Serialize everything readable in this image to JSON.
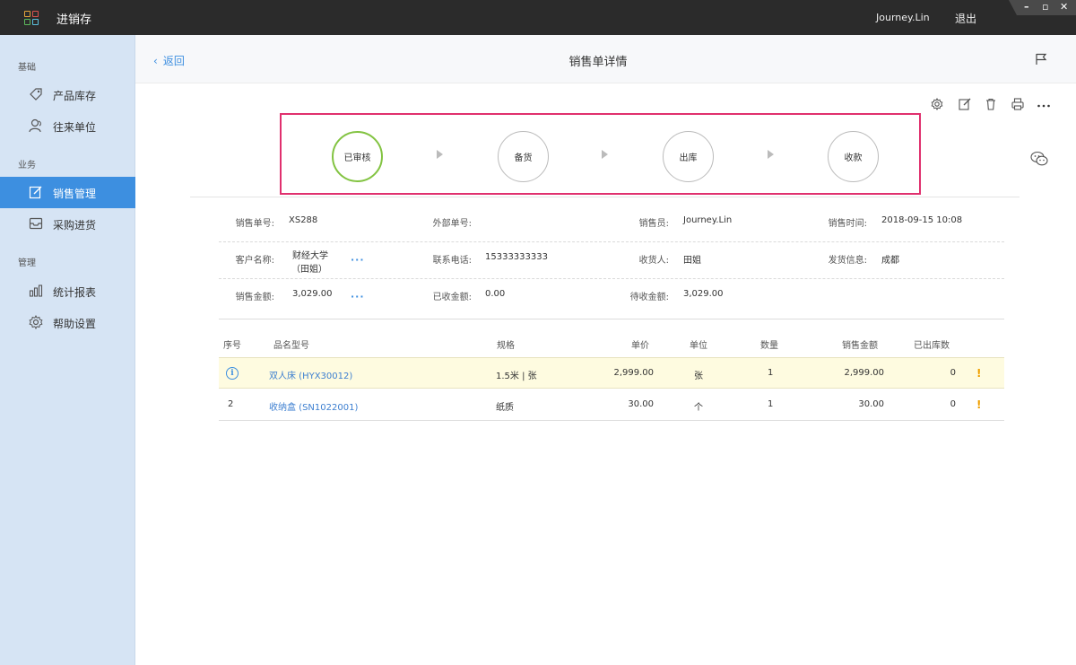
{
  "titlebar": {
    "app_title": "进销存",
    "user_name": "Journey.Lin",
    "logout": "退出",
    "minimize": "–",
    "maximize": "▫",
    "close": "✕"
  },
  "sidebar": {
    "groups": [
      {
        "label": "基础"
      },
      {
        "label": "业务"
      },
      {
        "label": "管理"
      }
    ],
    "items": [
      {
        "label": "产品库存",
        "icon": "tag-icon"
      },
      {
        "label": "往来单位",
        "icon": "contacts-icon"
      },
      {
        "label": "销售管理",
        "icon": "edit-icon",
        "active": true
      },
      {
        "label": "采购进货",
        "icon": "inbox-icon"
      },
      {
        "label": "统计报表",
        "icon": "bar-chart-icon"
      },
      {
        "label": "帮助设置",
        "icon": "gear-icon"
      }
    ]
  },
  "header": {
    "back_label": "返回",
    "title": "销售单详情"
  },
  "workflow": {
    "steps": [
      {
        "label": "已审核",
        "done": true
      },
      {
        "label": "备货",
        "done": false
      },
      {
        "label": "出库",
        "done": false
      },
      {
        "label": "收款",
        "done": false
      }
    ],
    "highlight_color": "#e0306e",
    "done_color": "#82c341"
  },
  "info": {
    "sale_no_label": "销售单号:",
    "sale_no": "XS288",
    "external_no_label": "外部单号:",
    "external_no": "",
    "salesperson_label": "销售员:",
    "salesperson": "Journey.Lin",
    "sale_time_label": "销售时间:",
    "sale_time": "2018-09-15 10:08",
    "customer_label": "客户名称:",
    "customer_line1": "财经大学",
    "customer_line2": "（田姐）",
    "phone_label": "联系电话:",
    "phone": "15333333333",
    "receiver_label": "收货人:",
    "receiver": "田姐",
    "ship_info_label": "发货信息:",
    "ship_info": "成都",
    "amount_label": "销售金额:",
    "amount": "3,029.00",
    "received_label": "已收金额:",
    "received": "0.00",
    "pending_label": "待收金额:",
    "pending": "3,029.00",
    "more": "···"
  },
  "table": {
    "headers": {
      "index": "序号",
      "name": "品名型号",
      "spec": "规格",
      "price": "单价",
      "unit": "单位",
      "qty": "数量",
      "amount": "销售金额",
      "shipped": "已出库数"
    },
    "rows": [
      {
        "index": "i",
        "name": "双人床 (HYX30012)",
        "spec": "1.5米 | 张",
        "price": "2,999.00",
        "unit": "张",
        "qty": "1",
        "amount": "2,999.00",
        "shipped": "0",
        "warn": "!"
      },
      {
        "index": "2",
        "name": "收纳盒 (SN1022001)",
        "spec": "纸质",
        "price": "30.00",
        "unit": "个",
        "qty": "1",
        "amount": "30.00",
        "shipped": "0",
        "warn": "!"
      }
    ]
  },
  "colors": {
    "accent": "#3d8fe0",
    "sidebar_bg": "#d6e4f4",
    "titlebar_bg": "#2b2b2b",
    "warning": "#f0a000",
    "row_highlight": "#fefbe0"
  }
}
